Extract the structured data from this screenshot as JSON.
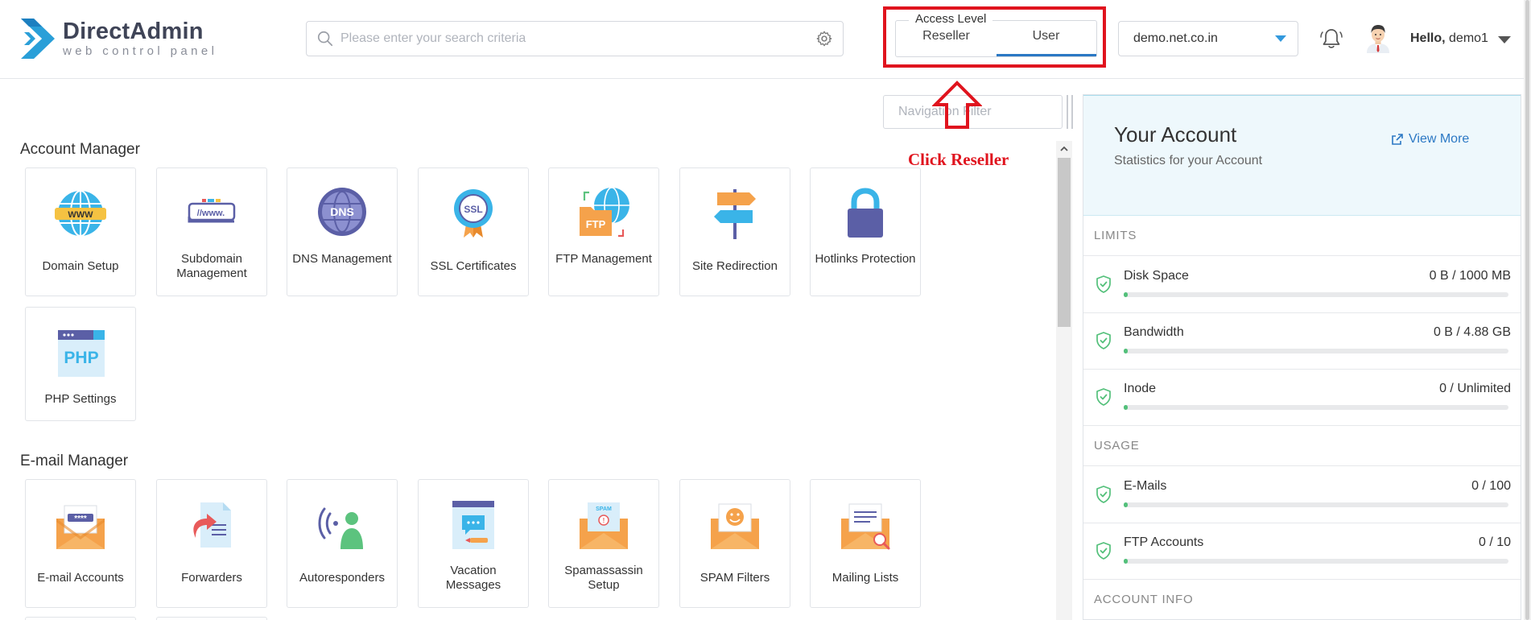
{
  "header": {
    "logo_name": "DirectAdmin",
    "logo_tagline": "web control panel",
    "search_placeholder": "Please enter your search criteria",
    "access_level": {
      "legend": "Access Level",
      "options": [
        "Reseller",
        "User"
      ],
      "selected": "User"
    },
    "domain": "demo.net.co.in",
    "greeting": "Hello,",
    "username": "demo1"
  },
  "navigation_filter_placeholder": "Navigation Filter",
  "annotation": {
    "text": "Click Reseller",
    "color": "#e0141e"
  },
  "sections": [
    {
      "title": "Account Manager",
      "items": [
        {
          "label": "Domain Setup",
          "icon": "www-globe-icon"
        },
        {
          "label": "Subdomain Management",
          "icon": "subdomain-icon"
        },
        {
          "label": "DNS Management",
          "icon": "dns-globe-icon"
        },
        {
          "label": "SSL Certificates",
          "icon": "ssl-badge-icon"
        },
        {
          "label": "FTP Management",
          "icon": "ftp-folder-icon"
        },
        {
          "label": "Site Redirection",
          "icon": "signpost-icon"
        },
        {
          "label": "Hotlinks Protection",
          "icon": "padlock-icon"
        },
        {
          "label": "PHP Settings",
          "icon": "php-window-icon"
        }
      ]
    },
    {
      "title": "E-mail Manager",
      "items": [
        {
          "label": "E-mail Accounts",
          "icon": "email-password-icon"
        },
        {
          "label": "Forwarders",
          "icon": "forward-document-icon"
        },
        {
          "label": "Autoresponders",
          "icon": "autoresponder-icon"
        },
        {
          "label": "Vacation Messages",
          "icon": "vacation-message-icon"
        },
        {
          "label": "Spamassassin Setup",
          "icon": "spam-envelope-icon"
        },
        {
          "label": "SPAM Filters",
          "icon": "smiley-envelope-icon"
        },
        {
          "label": "Mailing Lists",
          "icon": "mailing-list-icon"
        }
      ]
    }
  ],
  "account_panel": {
    "title": "Your Account",
    "subtitle": "Statistics for your Account",
    "view_more": "View More",
    "groups": [
      {
        "label": "LIMITS",
        "rows": [
          {
            "name": "Disk Space",
            "value": "0 B / 1000 MB",
            "usage": 0
          },
          {
            "name": "Bandwidth",
            "value": "0 B / 4.88 GB",
            "usage": 0
          },
          {
            "name": "Inode",
            "value": "0 / Unlimited",
            "usage": 0
          }
        ]
      },
      {
        "label": "USAGE",
        "rows": [
          {
            "name": "E-Mails",
            "value": "0 / 100",
            "usage": 0
          },
          {
            "name": "FTP Accounts",
            "value": "0 / 10",
            "usage": 0
          }
        ]
      },
      {
        "label": "ACCOUNT INFO",
        "rows": []
      }
    ]
  },
  "colors": {
    "accent": "#2b78c4",
    "highlight_box": "#e0141e",
    "progress": "#53c07a",
    "panel_header_bg": "#eef8fc"
  }
}
